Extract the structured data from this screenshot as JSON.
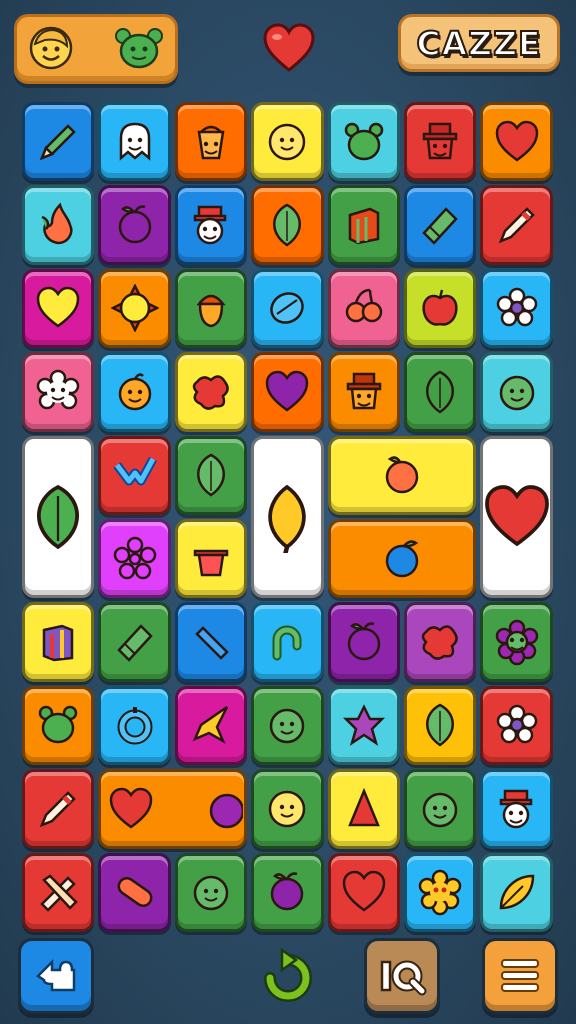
{
  "header": {
    "brand_label": "CAZZE",
    "left_avatars": [
      "smiley-face-icon",
      "green-blob-icon"
    ],
    "center_icon": "heart-icon"
  },
  "board": {
    "columns": 7,
    "tiles": [
      {
        "r": 0,
        "c": 0,
        "bg": "#1e88e5",
        "icon": "pencil"
      },
      {
        "r": 0,
        "c": 1,
        "bg": "#29b6f6",
        "icon": "ghost"
      },
      {
        "r": 0,
        "c": 2,
        "bg": "#ff6d00",
        "icon": "bucket"
      },
      {
        "r": 0,
        "c": 3,
        "bg": "#ffeb3b",
        "icon": "face-yellow"
      },
      {
        "r": 0,
        "c": 4,
        "bg": "#4dd0e1",
        "icon": "green-blob"
      },
      {
        "r": 0,
        "c": 5,
        "bg": "#e53935",
        "icon": "hat-face"
      },
      {
        "r": 0,
        "c": 6,
        "bg": "#fb8c00",
        "icon": "heart"
      },
      {
        "r": 1,
        "c": 0,
        "bg": "#4dd0e1",
        "icon": "flame"
      },
      {
        "r": 1,
        "c": 1,
        "bg": "#8e24aa",
        "icon": "plum"
      },
      {
        "r": 1,
        "c": 2,
        "bg": "#1e88e5",
        "icon": "snowman"
      },
      {
        "r": 1,
        "c": 3,
        "bg": "#ff6d00",
        "icon": "leaf"
      },
      {
        "r": 1,
        "c": 4,
        "bg": "#43a047",
        "icon": "box"
      },
      {
        "r": 1,
        "c": 5,
        "bg": "#1e88e5",
        "icon": "eraser"
      },
      {
        "r": 1,
        "c": 6,
        "bg": "#e53935",
        "icon": "pencil-white"
      },
      {
        "r": 2,
        "c": 0,
        "bg": "#d81b9e",
        "icon": "heart-yellow"
      },
      {
        "r": 2,
        "c": 1,
        "bg": "#fb8c00",
        "icon": "sun"
      },
      {
        "r": 2,
        "c": 2,
        "bg": "#43a047",
        "icon": "acorn"
      },
      {
        "r": 2,
        "c": 3,
        "bg": "#29b6f6",
        "icon": "bean"
      },
      {
        "r": 2,
        "c": 4,
        "bg": "#f06292",
        "icon": "cherry"
      },
      {
        "r": 2,
        "c": 5,
        "bg": "#c6e02a",
        "icon": "apple"
      },
      {
        "r": 2,
        "c": 6,
        "bg": "#29b6f6",
        "icon": "flower-white"
      },
      {
        "r": 3,
        "c": 0,
        "bg": "#f06292",
        "icon": "flower-face"
      },
      {
        "r": 3,
        "c": 1,
        "bg": "#29b6f6",
        "icon": "orange-face"
      },
      {
        "r": 3,
        "c": 2,
        "bg": "#ffeb3b",
        "icon": "red-blob"
      },
      {
        "r": 3,
        "c": 3,
        "bg": "#ff6d00",
        "icon": "heart-purple"
      },
      {
        "r": 3,
        "c": 4,
        "bg": "#fb8c00",
        "icon": "hat-face-orange"
      },
      {
        "r": 3,
        "c": 5,
        "bg": "#43a047",
        "icon": "leaf-dark"
      },
      {
        "r": 3,
        "c": 6,
        "bg": "#4dd0e1",
        "icon": "green-face"
      },
      {
        "r": 4,
        "c": 1,
        "bg": "#e53935",
        "icon": "check-heart"
      },
      {
        "r": 4,
        "c": 2,
        "bg": "#43a047",
        "icon": "leaf"
      },
      {
        "r": 5,
        "c": 1,
        "bg": "#e040fb",
        "icon": "pink-gear"
      },
      {
        "r": 5,
        "c": 2,
        "bg": "#ffeb3b",
        "icon": "pot"
      },
      {
        "r": 6,
        "c": 0,
        "bg": "#ffeb3b",
        "icon": "box-blue"
      },
      {
        "r": 6,
        "c": 1,
        "bg": "#43a047",
        "icon": "eraser"
      },
      {
        "r": 6,
        "c": 2,
        "bg": "#1e88e5",
        "icon": "stick"
      },
      {
        "r": 6,
        "c": 3,
        "bg": "#29b6f6",
        "icon": "hook"
      },
      {
        "r": 6,
        "c": 4,
        "bg": "#8e24aa",
        "icon": "plum"
      },
      {
        "r": 6,
        "c": 5,
        "bg": "#ab47bc",
        "icon": "red-blob"
      },
      {
        "r": 6,
        "c": 6,
        "bg": "#43a047",
        "icon": "purple-flower"
      },
      {
        "r": 7,
        "c": 0,
        "bg": "#fb8c00",
        "icon": "green-blob"
      },
      {
        "r": 7,
        "c": 1,
        "bg": "#29b6f6",
        "icon": "ring"
      },
      {
        "r": 7,
        "c": 2,
        "bg": "#d81b9e",
        "icon": "star"
      },
      {
        "r": 7,
        "c": 3,
        "bg": "#43a047",
        "icon": "green-face"
      },
      {
        "r": 7,
        "c": 4,
        "bg": "#4dd0e1",
        "icon": "purple-star"
      },
      {
        "r": 7,
        "c": 5,
        "bg": "#ffc107",
        "icon": "leaf"
      },
      {
        "r": 7,
        "c": 6,
        "bg": "#e53935",
        "icon": "flower-white"
      },
      {
        "r": 8,
        "c": 0,
        "bg": "#e53935",
        "icon": "pencil-white"
      },
      {
        "r": 8,
        "c": 3,
        "bg": "#43a047",
        "icon": "face-yellow"
      },
      {
        "r": 8,
        "c": 4,
        "bg": "#ffeb3b",
        "icon": "cone"
      },
      {
        "r": 8,
        "c": 5,
        "bg": "#43a047",
        "icon": "green-face"
      },
      {
        "r": 8,
        "c": 6,
        "bg": "#29b6f6",
        "icon": "snowman"
      },
      {
        "r": 9,
        "c": 0,
        "bg": "#e53935",
        "icon": "cross-tools"
      },
      {
        "r": 9,
        "c": 1,
        "bg": "#8e24aa",
        "icon": "pill"
      },
      {
        "r": 9,
        "c": 2,
        "bg": "#43a047",
        "icon": "green-face"
      },
      {
        "r": 9,
        "c": 3,
        "bg": "#43a047",
        "icon": "plum"
      },
      {
        "r": 9,
        "c": 4,
        "bg": "#e53935",
        "icon": "heart-red"
      },
      {
        "r": 9,
        "c": 5,
        "bg": "#29b6f6",
        "icon": "yellow-flower"
      },
      {
        "r": 9,
        "c": 6,
        "bg": "#4dd0e1",
        "icon": "yellow-leaf"
      }
    ],
    "big_tiles": [
      {
        "r": 4,
        "c": 0,
        "rs": 2,
        "cs": 1,
        "bg": "#ffffff",
        "icon": "leaf-green"
      },
      {
        "r": 4,
        "c": 3,
        "rs": 2,
        "cs": 1,
        "bg": "#ffffff",
        "icon": "lemon"
      },
      {
        "r": 4,
        "c": 4,
        "rs": 1,
        "cs": 2,
        "bg": "#ffeb3b",
        "icon": "orange-fruit"
      },
      {
        "r": 5,
        "c": 4,
        "rs": 1,
        "cs": 2,
        "bg": "#fb8c00",
        "icon": "blueberry"
      },
      {
        "r": 4,
        "c": 6,
        "rs": 2,
        "cs": 1,
        "bg": "#ffffff",
        "icon": "heart"
      },
      {
        "r": 8,
        "c": 1,
        "rs": 1,
        "cs": 2,
        "bg": "#fb8c00",
        "icon": "heart-plum-pair"
      }
    ]
  },
  "footer": {
    "buttons": [
      {
        "name": "back-button",
        "icon": "puzzle-back-icon",
        "bg": "#1e88e5"
      },
      {
        "name": "refresh-button",
        "icon": "refresh-arrow-icon",
        "bg": "none"
      },
      {
        "name": "hint-button",
        "icon": "hint-iq-icon",
        "bg": "#b98a56"
      },
      {
        "name": "menu-button",
        "icon": "menu-icon",
        "bg": "#f5a13b"
      }
    ]
  }
}
